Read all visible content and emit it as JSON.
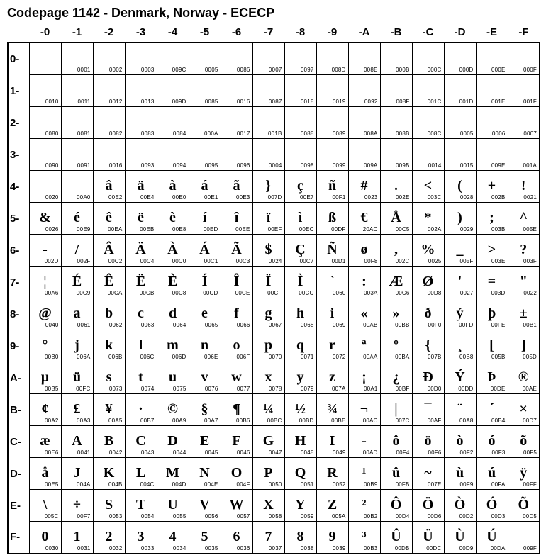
{
  "title": "Codepage 1142 - Denmark, Norway - ECECP",
  "col_headers": [
    "-0",
    "-1",
    "-2",
    "-3",
    "-4",
    "-5",
    "-6",
    "-7",
    "-8",
    "-9",
    "-A",
    "-B",
    "-C",
    "-D",
    "-E",
    "-F"
  ],
  "row_headers": [
    "0-",
    "1-",
    "2-",
    "3-",
    "4-",
    "5-",
    "6-",
    "7-",
    "8-",
    "9-",
    "A-",
    "B-",
    "C-",
    "D-",
    "E-",
    "F-"
  ],
  "chart_data": {
    "type": "table",
    "title": "Codepage 1142 - Denmark, Norway - ECECP",
    "rows": [
      [
        {
          "g": "",
          "c": ""
        },
        {
          "g": "",
          "c": "0001"
        },
        {
          "g": "",
          "c": "0002"
        },
        {
          "g": "",
          "c": "0003"
        },
        {
          "g": "",
          "c": "009C"
        },
        {
          "g": "",
          "c": "0005"
        },
        {
          "g": "",
          "c": "0086"
        },
        {
          "g": "",
          "c": "0007"
        },
        {
          "g": "",
          "c": "0097"
        },
        {
          "g": "",
          "c": "008D"
        },
        {
          "g": "",
          "c": "008E"
        },
        {
          "g": "",
          "c": "000B"
        },
        {
          "g": "",
          "c": "000C"
        },
        {
          "g": "",
          "c": "000D"
        },
        {
          "g": "",
          "c": "000E"
        },
        {
          "g": "",
          "c": "000F"
        }
      ],
      [
        {
          "g": "",
          "c": "0010"
        },
        {
          "g": "",
          "c": "0011"
        },
        {
          "g": "",
          "c": "0012"
        },
        {
          "g": "",
          "c": "0013"
        },
        {
          "g": "",
          "c": "009D"
        },
        {
          "g": "",
          "c": "0085"
        },
        {
          "g": "",
          "c": "0016"
        },
        {
          "g": "",
          "c": "0087"
        },
        {
          "g": "",
          "c": "0018"
        },
        {
          "g": "",
          "c": "0019"
        },
        {
          "g": "",
          "c": "0092"
        },
        {
          "g": "",
          "c": "008F"
        },
        {
          "g": "",
          "c": "001C"
        },
        {
          "g": "",
          "c": "001D"
        },
        {
          "g": "",
          "c": "001E"
        },
        {
          "g": "",
          "c": "001F"
        }
      ],
      [
        {
          "g": "",
          "c": "0080"
        },
        {
          "g": "",
          "c": "0081"
        },
        {
          "g": "",
          "c": "0082"
        },
        {
          "g": "",
          "c": "0083"
        },
        {
          "g": "",
          "c": "0084"
        },
        {
          "g": "",
          "c": "000A"
        },
        {
          "g": "",
          "c": "0017"
        },
        {
          "g": "",
          "c": "001B"
        },
        {
          "g": "",
          "c": "0088"
        },
        {
          "g": "",
          "c": "0089"
        },
        {
          "g": "",
          "c": "008A"
        },
        {
          "g": "",
          "c": "008B"
        },
        {
          "g": "",
          "c": "008C"
        },
        {
          "g": "",
          "c": "0005"
        },
        {
          "g": "",
          "c": "0006"
        },
        {
          "g": "",
          "c": "0007"
        }
      ],
      [
        {
          "g": "",
          "c": "0090"
        },
        {
          "g": "",
          "c": "0091"
        },
        {
          "g": "",
          "c": "0016"
        },
        {
          "g": "",
          "c": "0093"
        },
        {
          "g": "",
          "c": "0094"
        },
        {
          "g": "",
          "c": "0095"
        },
        {
          "g": "",
          "c": "0096"
        },
        {
          "g": "",
          "c": "0004"
        },
        {
          "g": "",
          "c": "0098"
        },
        {
          "g": "",
          "c": "0099"
        },
        {
          "g": "",
          "c": "009A"
        },
        {
          "g": "",
          "c": "009B"
        },
        {
          "g": "",
          "c": "0014"
        },
        {
          "g": "",
          "c": "0015"
        },
        {
          "g": "",
          "c": "009E"
        },
        {
          "g": "",
          "c": "001A"
        }
      ],
      [
        {
          "g": "",
          "c": "0020"
        },
        {
          "g": "",
          "c": "00A0"
        },
        {
          "g": "â",
          "c": "00E2"
        },
        {
          "g": "ä",
          "c": "00E4"
        },
        {
          "g": "à",
          "c": "00E0"
        },
        {
          "g": "á",
          "c": "00E1"
        },
        {
          "g": "ã",
          "c": "00E3"
        },
        {
          "g": "}",
          "c": "007D"
        },
        {
          "g": "ç",
          "c": "00E7"
        },
        {
          "g": "ñ",
          "c": "00F1"
        },
        {
          "g": "#",
          "c": "0023"
        },
        {
          "g": ".",
          "c": "002E"
        },
        {
          "g": "<",
          "c": "003C"
        },
        {
          "g": "(",
          "c": "0028"
        },
        {
          "g": "+",
          "c": "002B"
        },
        {
          "g": "!",
          "c": "0021"
        }
      ],
      [
        {
          "g": "&",
          "c": "0026"
        },
        {
          "g": "é",
          "c": "00E9"
        },
        {
          "g": "ê",
          "c": "00EA"
        },
        {
          "g": "ë",
          "c": "00EB"
        },
        {
          "g": "è",
          "c": "00E8"
        },
        {
          "g": "í",
          "c": "00ED"
        },
        {
          "g": "î",
          "c": "00EE"
        },
        {
          "g": "ï",
          "c": "00EF"
        },
        {
          "g": "ì",
          "c": "00EC"
        },
        {
          "g": "ß",
          "c": "00DF"
        },
        {
          "g": "€",
          "c": "20AC"
        },
        {
          "g": "Å",
          "c": "00C5"
        },
        {
          "g": "*",
          "c": "002A"
        },
        {
          "g": ")",
          "c": "0029"
        },
        {
          "g": ";",
          "c": "003B"
        },
        {
          "g": "^",
          "c": "005E"
        }
      ],
      [
        {
          "g": "-",
          "c": "002D"
        },
        {
          "g": "/",
          "c": "002F"
        },
        {
          "g": "Â",
          "c": "00C2"
        },
        {
          "g": "Ä",
          "c": "00C4"
        },
        {
          "g": "À",
          "c": "00C0"
        },
        {
          "g": "Á",
          "c": "00C1"
        },
        {
          "g": "Ã",
          "c": "00C3"
        },
        {
          "g": "$",
          "c": "0024"
        },
        {
          "g": "Ç",
          "c": "00C7"
        },
        {
          "g": "Ñ",
          "c": "00D1"
        },
        {
          "g": "ø",
          "c": "00F8"
        },
        {
          "g": ",",
          "c": "002C"
        },
        {
          "g": "%",
          "c": "0025"
        },
        {
          "g": "_",
          "c": "005F"
        },
        {
          "g": ">",
          "c": "003E"
        },
        {
          "g": "?",
          "c": "003F"
        }
      ],
      [
        {
          "g": "¦",
          "c": "00A6"
        },
        {
          "g": "É",
          "c": "00C9"
        },
        {
          "g": "Ê",
          "c": "00CA"
        },
        {
          "g": "Ë",
          "c": "00CB"
        },
        {
          "g": "È",
          "c": "00C8"
        },
        {
          "g": "Í",
          "c": "00CD"
        },
        {
          "g": "Î",
          "c": "00CE"
        },
        {
          "g": "Ï",
          "c": "00CF"
        },
        {
          "g": "Ì",
          "c": "00CC"
        },
        {
          "g": "`",
          "c": "0060"
        },
        {
          "g": ":",
          "c": "003A"
        },
        {
          "g": "Æ",
          "c": "00C6"
        },
        {
          "g": "Ø",
          "c": "00D8"
        },
        {
          "g": "'",
          "c": "0027"
        },
        {
          "g": "=",
          "c": "003D"
        },
        {
          "g": "\"",
          "c": "0022"
        }
      ],
      [
        {
          "g": "@",
          "c": "0040"
        },
        {
          "g": "a",
          "c": "0061"
        },
        {
          "g": "b",
          "c": "0062"
        },
        {
          "g": "c",
          "c": "0063"
        },
        {
          "g": "d",
          "c": "0064"
        },
        {
          "g": "e",
          "c": "0065"
        },
        {
          "g": "f",
          "c": "0066"
        },
        {
          "g": "g",
          "c": "0067"
        },
        {
          "g": "h",
          "c": "0068"
        },
        {
          "g": "i",
          "c": "0069"
        },
        {
          "g": "«",
          "c": "00AB"
        },
        {
          "g": "»",
          "c": "00BB"
        },
        {
          "g": "ð",
          "c": "00F0"
        },
        {
          "g": "ý",
          "c": "00FD"
        },
        {
          "g": "þ",
          "c": "00FE"
        },
        {
          "g": "±",
          "c": "00B1"
        }
      ],
      [
        {
          "g": "°",
          "c": "00B0"
        },
        {
          "g": "j",
          "c": "006A"
        },
        {
          "g": "k",
          "c": "006B"
        },
        {
          "g": "l",
          "c": "006C"
        },
        {
          "g": "m",
          "c": "006D"
        },
        {
          "g": "n",
          "c": "006E"
        },
        {
          "g": "o",
          "c": "006F"
        },
        {
          "g": "p",
          "c": "0070"
        },
        {
          "g": "q",
          "c": "0071"
        },
        {
          "g": "r",
          "c": "0072"
        },
        {
          "g": "ª",
          "c": "00AA"
        },
        {
          "g": "º",
          "c": "00BA"
        },
        {
          "g": "{",
          "c": "007B"
        },
        {
          "g": "¸",
          "c": "00B8"
        },
        {
          "g": "[",
          "c": "005B"
        },
        {
          "g": "]",
          "c": "005D"
        }
      ],
      [
        {
          "g": "µ",
          "c": "00B5"
        },
        {
          "g": "ü",
          "c": "00FC"
        },
        {
          "g": "s",
          "c": "0073"
        },
        {
          "g": "t",
          "c": "0074"
        },
        {
          "g": "u",
          "c": "0075"
        },
        {
          "g": "v",
          "c": "0076"
        },
        {
          "g": "w",
          "c": "0077"
        },
        {
          "g": "x",
          "c": "0078"
        },
        {
          "g": "y",
          "c": "0079"
        },
        {
          "g": "z",
          "c": "007A"
        },
        {
          "g": "¡",
          "c": "00A1"
        },
        {
          "g": "¿",
          "c": "00BF"
        },
        {
          "g": "Ð",
          "c": "00D0"
        },
        {
          "g": "Ý",
          "c": "00DD"
        },
        {
          "g": "Þ",
          "c": "00DE"
        },
        {
          "g": "®",
          "c": "00AE"
        }
      ],
      [
        {
          "g": "¢",
          "c": "00A2"
        },
        {
          "g": "£",
          "c": "00A3"
        },
        {
          "g": "¥",
          "c": "00A5"
        },
        {
          "g": "·",
          "c": "00B7"
        },
        {
          "g": "©",
          "c": "00A9"
        },
        {
          "g": "§",
          "c": "00A7"
        },
        {
          "g": "¶",
          "c": "00B6"
        },
        {
          "g": "¼",
          "c": "00BC"
        },
        {
          "g": "½",
          "c": "00BD"
        },
        {
          "g": "¾",
          "c": "00BE"
        },
        {
          "g": "¬",
          "c": "00AC"
        },
        {
          "g": "|",
          "c": "007C"
        },
        {
          "g": "¯",
          "c": "00AF"
        },
        {
          "g": "¨",
          "c": "00A8"
        },
        {
          "g": "´",
          "c": "00B4"
        },
        {
          "g": "×",
          "c": "00D7"
        }
      ],
      [
        {
          "g": "æ",
          "c": "00E6"
        },
        {
          "g": "A",
          "c": "0041"
        },
        {
          "g": "B",
          "c": "0042"
        },
        {
          "g": "C",
          "c": "0043"
        },
        {
          "g": "D",
          "c": "0044"
        },
        {
          "g": "E",
          "c": "0045"
        },
        {
          "g": "F",
          "c": "0046"
        },
        {
          "g": "G",
          "c": "0047"
        },
        {
          "g": "H",
          "c": "0048"
        },
        {
          "g": "I",
          "c": "0049"
        },
        {
          "g": "­-",
          "c": "00AD"
        },
        {
          "g": "ô",
          "c": "00F4"
        },
        {
          "g": "ö",
          "c": "00F6"
        },
        {
          "g": "ò",
          "c": "00F2"
        },
        {
          "g": "ó",
          "c": "00F3"
        },
        {
          "g": "õ",
          "c": "00F5"
        }
      ],
      [
        {
          "g": "å",
          "c": "00E5"
        },
        {
          "g": "J",
          "c": "004A"
        },
        {
          "g": "K",
          "c": "004B"
        },
        {
          "g": "L",
          "c": "004C"
        },
        {
          "g": "M",
          "c": "004D"
        },
        {
          "g": "N",
          "c": "004E"
        },
        {
          "g": "O",
          "c": "004F"
        },
        {
          "g": "P",
          "c": "0050"
        },
        {
          "g": "Q",
          "c": "0051"
        },
        {
          "g": "R",
          "c": "0052"
        },
        {
          "g": "¹",
          "c": "00B9"
        },
        {
          "g": "û",
          "c": "00FB"
        },
        {
          "g": "~",
          "c": "007E"
        },
        {
          "g": "ù",
          "c": "00F9"
        },
        {
          "g": "ú",
          "c": "00FA"
        },
        {
          "g": "ÿ",
          "c": "00FF"
        }
      ],
      [
        {
          "g": "\\",
          "c": "005C"
        },
        {
          "g": "÷",
          "c": "00F7"
        },
        {
          "g": "S",
          "c": "0053"
        },
        {
          "g": "T",
          "c": "0054"
        },
        {
          "g": "U",
          "c": "0055"
        },
        {
          "g": "V",
          "c": "0056"
        },
        {
          "g": "W",
          "c": "0057"
        },
        {
          "g": "X",
          "c": "0058"
        },
        {
          "g": "Y",
          "c": "0059"
        },
        {
          "g": "Z",
          "c": "005A"
        },
        {
          "g": "²",
          "c": "00B2"
        },
        {
          "g": "Ô",
          "c": "00D4"
        },
        {
          "g": "Ö",
          "c": "00D6"
        },
        {
          "g": "Ò",
          "c": "00D2"
        },
        {
          "g": "Ó",
          "c": "00D3"
        },
        {
          "g": "Õ",
          "c": "00D5"
        }
      ],
      [
        {
          "g": "0",
          "c": "0030"
        },
        {
          "g": "1",
          "c": "0031"
        },
        {
          "g": "2",
          "c": "0032"
        },
        {
          "g": "3",
          "c": "0033"
        },
        {
          "g": "4",
          "c": "0034"
        },
        {
          "g": "5",
          "c": "0035"
        },
        {
          "g": "6",
          "c": "0036"
        },
        {
          "g": "7",
          "c": "0037"
        },
        {
          "g": "8",
          "c": "0038"
        },
        {
          "g": "9",
          "c": "0039"
        },
        {
          "g": "³",
          "c": "00B3"
        },
        {
          "g": "Û",
          "c": "00DB"
        },
        {
          "g": "Ü",
          "c": "00DC"
        },
        {
          "g": "Ù",
          "c": "00D9"
        },
        {
          "g": "Ú",
          "c": "00DA"
        },
        {
          "g": "",
          "c": "009F"
        }
      ]
    ]
  }
}
